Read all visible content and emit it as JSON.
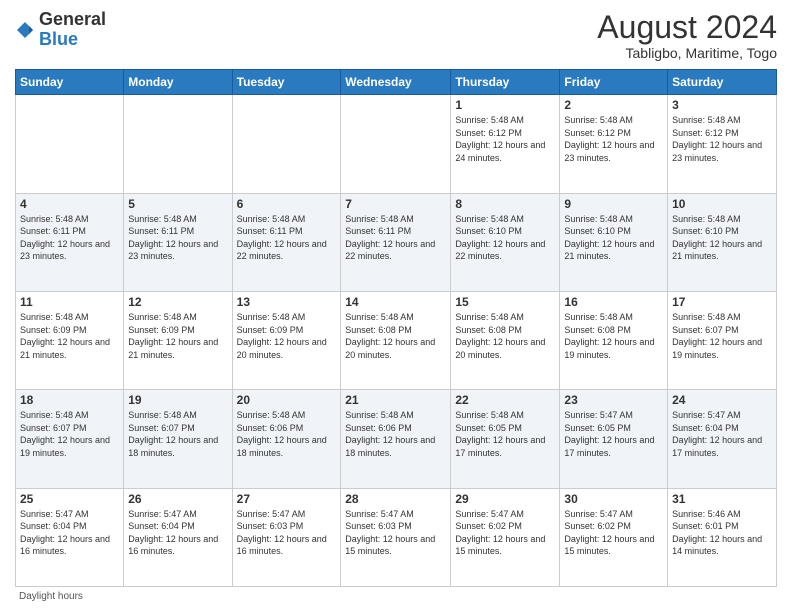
{
  "logo": {
    "general": "General",
    "blue": "Blue"
  },
  "title": "August 2024",
  "subtitle": "Tabligbo, Maritime, Togo",
  "days_of_week": [
    "Sunday",
    "Monday",
    "Tuesday",
    "Wednesday",
    "Thursday",
    "Friday",
    "Saturday"
  ],
  "footer": "Daylight hours",
  "weeks": [
    [
      {
        "day": "",
        "info": ""
      },
      {
        "day": "",
        "info": ""
      },
      {
        "day": "",
        "info": ""
      },
      {
        "day": "",
        "info": ""
      },
      {
        "day": "1",
        "info": "Sunrise: 5:48 AM\nSunset: 6:12 PM\nDaylight: 12 hours and 24 minutes."
      },
      {
        "day": "2",
        "info": "Sunrise: 5:48 AM\nSunset: 6:12 PM\nDaylight: 12 hours and 23 minutes."
      },
      {
        "day": "3",
        "info": "Sunrise: 5:48 AM\nSunset: 6:12 PM\nDaylight: 12 hours and 23 minutes."
      }
    ],
    [
      {
        "day": "4",
        "info": "Sunrise: 5:48 AM\nSunset: 6:11 PM\nDaylight: 12 hours and 23 minutes."
      },
      {
        "day": "5",
        "info": "Sunrise: 5:48 AM\nSunset: 6:11 PM\nDaylight: 12 hours and 23 minutes."
      },
      {
        "day": "6",
        "info": "Sunrise: 5:48 AM\nSunset: 6:11 PM\nDaylight: 12 hours and 22 minutes."
      },
      {
        "day": "7",
        "info": "Sunrise: 5:48 AM\nSunset: 6:11 PM\nDaylight: 12 hours and 22 minutes."
      },
      {
        "day": "8",
        "info": "Sunrise: 5:48 AM\nSunset: 6:10 PM\nDaylight: 12 hours and 22 minutes."
      },
      {
        "day": "9",
        "info": "Sunrise: 5:48 AM\nSunset: 6:10 PM\nDaylight: 12 hours and 21 minutes."
      },
      {
        "day": "10",
        "info": "Sunrise: 5:48 AM\nSunset: 6:10 PM\nDaylight: 12 hours and 21 minutes."
      }
    ],
    [
      {
        "day": "11",
        "info": "Sunrise: 5:48 AM\nSunset: 6:09 PM\nDaylight: 12 hours and 21 minutes."
      },
      {
        "day": "12",
        "info": "Sunrise: 5:48 AM\nSunset: 6:09 PM\nDaylight: 12 hours and 21 minutes."
      },
      {
        "day": "13",
        "info": "Sunrise: 5:48 AM\nSunset: 6:09 PM\nDaylight: 12 hours and 20 minutes."
      },
      {
        "day": "14",
        "info": "Sunrise: 5:48 AM\nSunset: 6:08 PM\nDaylight: 12 hours and 20 minutes."
      },
      {
        "day": "15",
        "info": "Sunrise: 5:48 AM\nSunset: 6:08 PM\nDaylight: 12 hours and 20 minutes."
      },
      {
        "day": "16",
        "info": "Sunrise: 5:48 AM\nSunset: 6:08 PM\nDaylight: 12 hours and 19 minutes."
      },
      {
        "day": "17",
        "info": "Sunrise: 5:48 AM\nSunset: 6:07 PM\nDaylight: 12 hours and 19 minutes."
      }
    ],
    [
      {
        "day": "18",
        "info": "Sunrise: 5:48 AM\nSunset: 6:07 PM\nDaylight: 12 hours and 19 minutes."
      },
      {
        "day": "19",
        "info": "Sunrise: 5:48 AM\nSunset: 6:07 PM\nDaylight: 12 hours and 18 minutes."
      },
      {
        "day": "20",
        "info": "Sunrise: 5:48 AM\nSunset: 6:06 PM\nDaylight: 12 hours and 18 minutes."
      },
      {
        "day": "21",
        "info": "Sunrise: 5:48 AM\nSunset: 6:06 PM\nDaylight: 12 hours and 18 minutes."
      },
      {
        "day": "22",
        "info": "Sunrise: 5:48 AM\nSunset: 6:05 PM\nDaylight: 12 hours and 17 minutes."
      },
      {
        "day": "23",
        "info": "Sunrise: 5:47 AM\nSunset: 6:05 PM\nDaylight: 12 hours and 17 minutes."
      },
      {
        "day": "24",
        "info": "Sunrise: 5:47 AM\nSunset: 6:04 PM\nDaylight: 12 hours and 17 minutes."
      }
    ],
    [
      {
        "day": "25",
        "info": "Sunrise: 5:47 AM\nSunset: 6:04 PM\nDaylight: 12 hours and 16 minutes."
      },
      {
        "day": "26",
        "info": "Sunrise: 5:47 AM\nSunset: 6:04 PM\nDaylight: 12 hours and 16 minutes."
      },
      {
        "day": "27",
        "info": "Sunrise: 5:47 AM\nSunset: 6:03 PM\nDaylight: 12 hours and 16 minutes."
      },
      {
        "day": "28",
        "info": "Sunrise: 5:47 AM\nSunset: 6:03 PM\nDaylight: 12 hours and 15 minutes."
      },
      {
        "day": "29",
        "info": "Sunrise: 5:47 AM\nSunset: 6:02 PM\nDaylight: 12 hours and 15 minutes."
      },
      {
        "day": "30",
        "info": "Sunrise: 5:47 AM\nSunset: 6:02 PM\nDaylight: 12 hours and 15 minutes."
      },
      {
        "day": "31",
        "info": "Sunrise: 5:46 AM\nSunset: 6:01 PM\nDaylight: 12 hours and 14 minutes."
      }
    ]
  ]
}
